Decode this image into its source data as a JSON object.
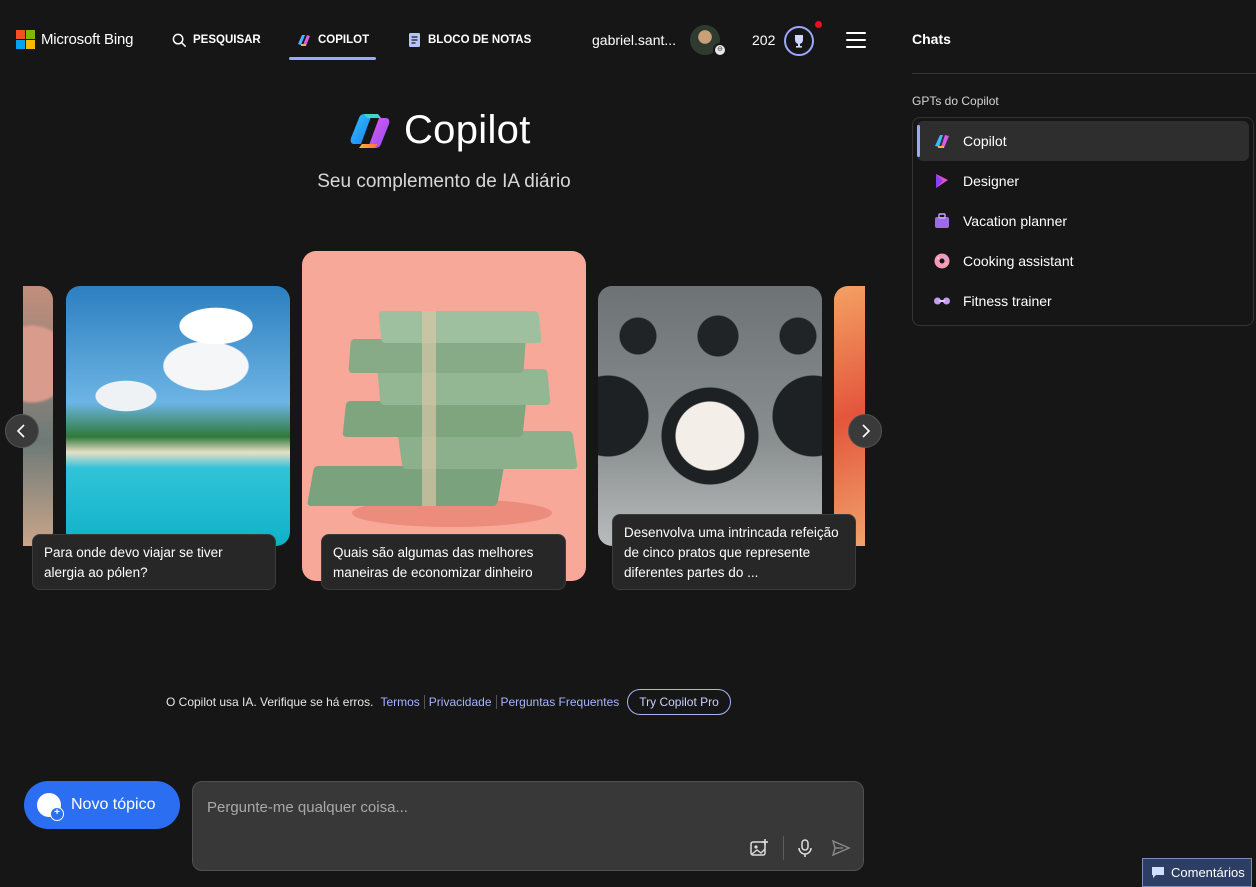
{
  "header": {
    "brand": "Microsoft Bing",
    "nav": [
      {
        "label": "PESQUISAR",
        "icon": "search-icon"
      },
      {
        "label": "COPILOT",
        "icon": "copilot-icon",
        "active": true
      },
      {
        "label": "BLOCO DE NOTAS",
        "icon": "notebook-icon"
      }
    ],
    "user_name": "gabriel.sant...",
    "points": "202",
    "colors": {
      "accent": "#9aa8ff",
      "notification": "#e81123"
    }
  },
  "hero": {
    "title": "Copilot",
    "subtitle": "Seu complemento de IA diário"
  },
  "carousel": {
    "cards": [
      {
        "caption": "Para onde devo viajar se tiver alergia ao pólen?"
      },
      {
        "caption": "Quais são algumas das melhores maneiras de economizar dinheiro"
      },
      {
        "caption": "Desenvolva uma intrincada refeição de cinco pratos que represente diferentes partes do ..."
      }
    ]
  },
  "footer": {
    "disclaimer": "O Copilot usa IA. Verifique se há erros.",
    "links": [
      "Termos",
      "Privacidade",
      "Perguntas Frequentes"
    ],
    "try_pro": "Try Copilot Pro"
  },
  "composer": {
    "new_topic": "Novo tópico",
    "placeholder": "Pergunte-me qualquer coisa...",
    "value": "",
    "new_topic_color": "#2b6ef2"
  },
  "panel": {
    "title": "Chats",
    "gpts_label": "GPTs do Copilot",
    "gpts": [
      {
        "label": "Copilot",
        "icon": "copilot-icon",
        "active": true
      },
      {
        "label": "Designer",
        "icon": "designer-icon"
      },
      {
        "label": "Vacation planner",
        "icon": "suitcase-icon"
      },
      {
        "label": "Cooking assistant",
        "icon": "donut-icon"
      },
      {
        "label": "Fitness trainer",
        "icon": "dumbbell-icon"
      }
    ]
  },
  "feedback": {
    "label": "Comentários"
  }
}
